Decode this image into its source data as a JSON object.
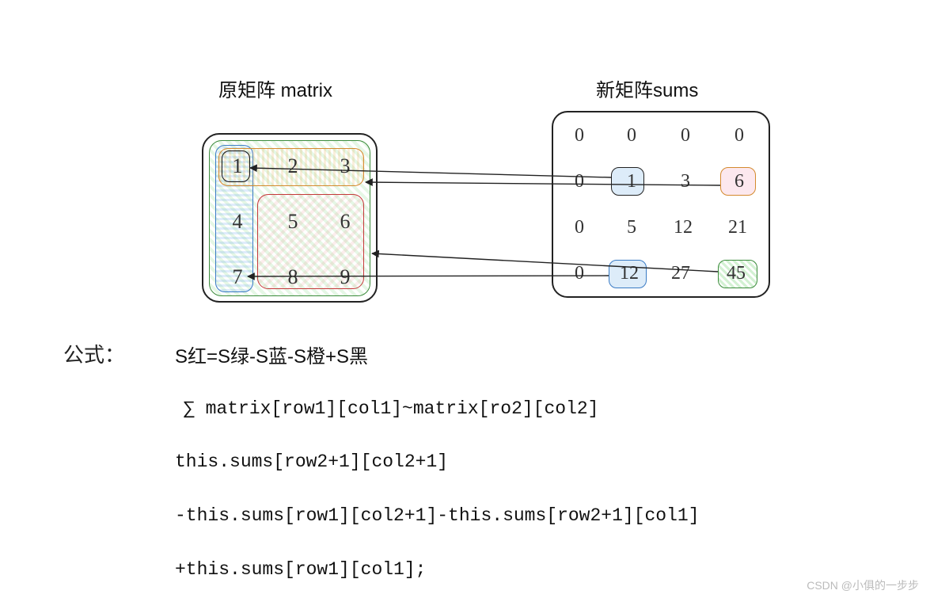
{
  "titles": {
    "left": "原矩阵 matrix",
    "right": "新矩阵sums"
  },
  "formula": {
    "label": "公式：",
    "line1": "S红=S绿-S蓝-S橙+S黑",
    "line2": "∑ matrix[row1][col1]~matrix[ro2][col2]",
    "line3": "this.sums[row2+1][col2+1]",
    "line4": "-this.sums[row1][col2+1]-this.sums[row2+1][col1]",
    "line5": "+this.sums[row1][col1];"
  },
  "watermark": "CSDN @小俱的一步步",
  "chart_data": {
    "type": "table",
    "title": "2D prefix-sum (integral image) illustration",
    "matrix": {
      "label": "原矩阵 matrix",
      "rows": 3,
      "cols": 3,
      "values": [
        [
          1,
          2,
          3
        ],
        [
          4,
          5,
          6
        ],
        [
          7,
          8,
          9
        ]
      ]
    },
    "sums": {
      "label": "新矩阵 sums",
      "rows": 4,
      "cols": 4,
      "values": [
        [
          0,
          0,
          0,
          0
        ],
        [
          0,
          1,
          3,
          6
        ],
        [
          0,
          5,
          12,
          21
        ],
        [
          0,
          12,
          27,
          45
        ]
      ]
    },
    "regions_on_matrix": [
      {
        "name": "S绿",
        "color": "green",
        "rows": "0..2",
        "cols": "0..2",
        "meaning": "sum of entire matrix"
      },
      {
        "name": "S蓝",
        "color": "blue",
        "rows": "0..2",
        "cols": "0",
        "meaning": "first column"
      },
      {
        "name": "S橙",
        "color": "orange",
        "rows": "0",
        "cols": "0..2",
        "meaning": "first row"
      },
      {
        "name": "S黑",
        "color": "black",
        "rows": "0",
        "cols": "0",
        "meaning": "top-left cell"
      },
      {
        "name": "S红",
        "color": "red",
        "rows": "1..2",
        "cols": "1..2",
        "meaning": "target sub-region"
      }
    ],
    "highlighted_sums_cells": [
      {
        "row": 1,
        "col": 1,
        "value": 1,
        "color": "black",
        "role": "+S黑 (sums[row1][col1])"
      },
      {
        "row": 1,
        "col": 3,
        "value": 6,
        "color": "orange",
        "role": "-S橙 (sums[row1][col2+1])"
      },
      {
        "row": 3,
        "col": 1,
        "value": 12,
        "color": "blue",
        "role": "-S蓝 (sums[row2+1][col1])"
      },
      {
        "row": 3,
        "col": 3,
        "value": 45,
        "color": "green",
        "role": "+S绿 (sums[row2+1][col2+1])"
      }
    ],
    "arrows": [
      {
        "from": "sums[1][1]=1",
        "to": "matrix cell (0,0)=1"
      },
      {
        "from": "sums[1][3]=6",
        "to": "orange first-row region"
      },
      {
        "from": "sums[3][1]=12",
        "to": "matrix cell (2,0)=7 / blue column region"
      },
      {
        "from": "sums[3][3]=45",
        "to": "green whole-matrix region"
      }
    ],
    "formula": "S红 = S绿 - S蓝 - S橙 + S黑  ⇔  Σ matrix[row1..row2][col1..col2] = sums[row2+1][col2+1] - sums[row1][col2+1] - sums[row2+1][col1] + sums[row1][col1]"
  },
  "matrix_cells": {
    "r0c0": "1",
    "r0c1": "2",
    "r0c2": "3",
    "r1c0": "4",
    "r1c1": "5",
    "r1c2": "6",
    "r2c0": "7",
    "r2c1": "8",
    "r2c2": "9"
  },
  "sums_cells": {
    "r0c0": "0",
    "r0c1": "0",
    "r0c2": "0",
    "r0c3": "0",
    "r1c0": "0",
    "r1c1": "1",
    "r1c2": "3",
    "r1c3": "6",
    "r2c0": "0",
    "r2c1": "5",
    "r2c2": "12",
    "r2c3": "21",
    "r3c0": "0",
    "r3c1": "12",
    "r3c2": "27",
    "r3c3": "45"
  }
}
